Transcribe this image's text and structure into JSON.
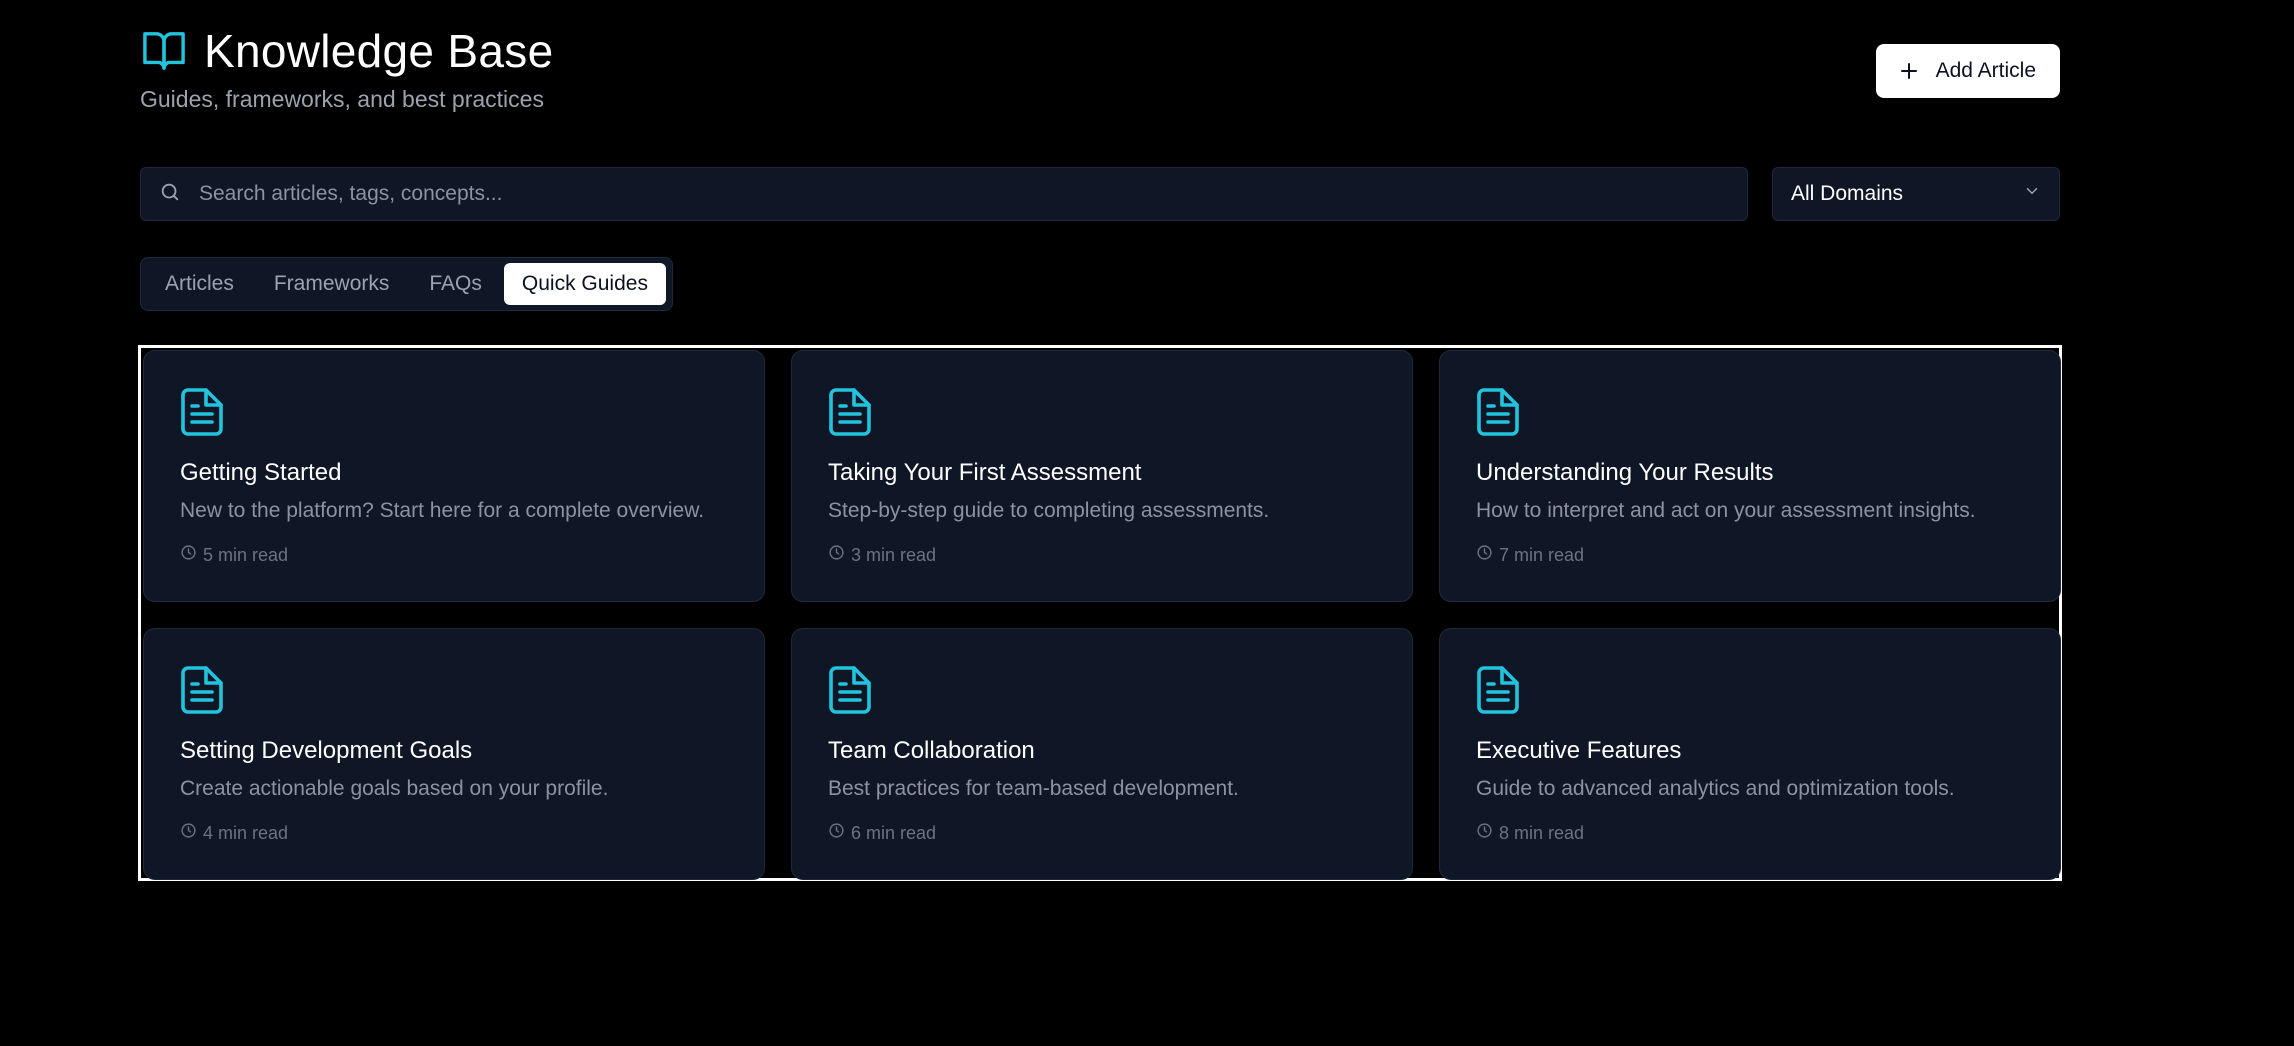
{
  "header": {
    "title": "Knowledge Base",
    "subtitle": "Guides, frameworks, and best practices",
    "add_button_label": "Add Article"
  },
  "search": {
    "placeholder": "Search articles, tags, concepts...",
    "value": ""
  },
  "domain_filter": {
    "selected": "All Domains"
  },
  "tabs": [
    {
      "label": "Articles",
      "active": false
    },
    {
      "label": "Frameworks",
      "active": false
    },
    {
      "label": "FAQs",
      "active": false
    },
    {
      "label": "Quick Guides",
      "active": true
    }
  ],
  "guides": [
    {
      "title": "Getting Started",
      "description": "New to the platform? Start here for a complete overview.",
      "read_time": "5 min read"
    },
    {
      "title": "Taking Your First Assessment",
      "description": "Step-by-step guide to completing assessments.",
      "read_time": "3 min read"
    },
    {
      "title": "Understanding Your Results",
      "description": "How to interpret and act on your assessment insights.",
      "read_time": "7 min read"
    },
    {
      "title": "Setting Development Goals",
      "description": "Create actionable goals based on your profile.",
      "read_time": "4 min read"
    },
    {
      "title": "Team Collaboration",
      "description": "Best practices for team-based development.",
      "read_time": "6 min read"
    },
    {
      "title": "Executive Features",
      "description": "Guide to advanced analytics and optimization tools.",
      "read_time": "8 min read"
    }
  ],
  "icons": {
    "title": "book-open-icon",
    "add": "plus-icon",
    "search": "search-icon",
    "dropdown": "chevron-down-icon",
    "card": "file-text-icon",
    "read_time": "clock-icon"
  },
  "colors": {
    "accent": "#22c3dd",
    "background": "#000000",
    "surface": "#0f1726",
    "border": "#1f2a3c",
    "muted_text": "#8b93a1"
  }
}
